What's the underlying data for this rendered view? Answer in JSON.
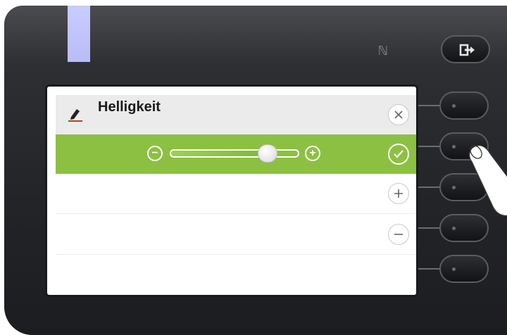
{
  "menu": {
    "title": "Helligkeit",
    "edit_icon": "pencil-icon",
    "close_icon": "close-icon",
    "confirm_icon": "check-icon",
    "increase_icon": "plus-icon",
    "decrease_icon": "minus-icon"
  },
  "slider": {
    "minus_label": "−",
    "plus_label": "+",
    "level": 0.8
  },
  "device": {
    "nfc_icon": "nfc-icon",
    "exit_icon": "exit-icon",
    "accent_color": "#8cc043",
    "led_color": "#c9ccff"
  }
}
